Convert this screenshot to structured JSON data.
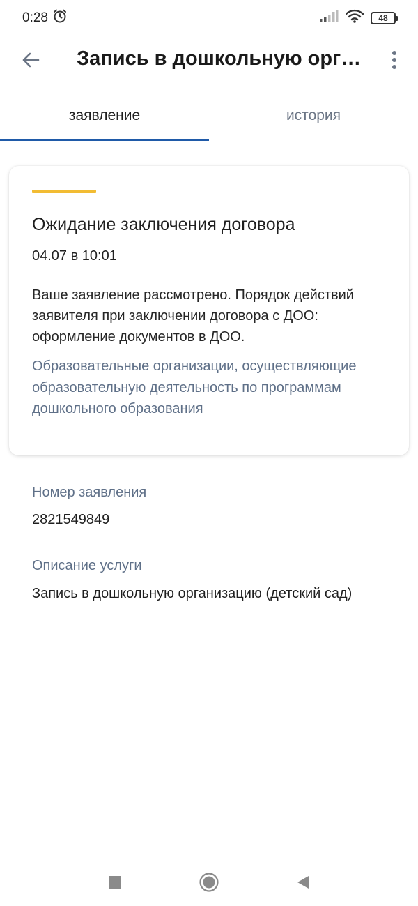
{
  "status_bar": {
    "time": "0:28",
    "battery": "48",
    "icons": [
      "alarm-icon",
      "signal-icon",
      "wifi-icon",
      "battery-icon"
    ]
  },
  "app_bar": {
    "title": "Запись в дошкольную орг…",
    "back_icon": "arrow-left-icon",
    "menu_icon": "more-vertical-icon"
  },
  "tabs": [
    {
      "label": "заявление",
      "active": true
    },
    {
      "label": "история",
      "active": false
    }
  ],
  "status_card": {
    "accent_color": "#f2bc33",
    "title": "Ожидание заключения договора",
    "date": "04.07 в 10:01",
    "text": "Ваше заявление рассмотрено. Порядок действий заявителя при заключении договора с ДОО: оформление документов в ДОО.",
    "link": "Образовательные организации, осуществляющие образовательную деятельность по программам дошкольного образования"
  },
  "application": {
    "number_label": "Номер заявления",
    "number_value": "2821549849",
    "description_label": "Описание услуги",
    "description_value": "Запись в дошкольную организацию (детский сад)"
  },
  "colors": {
    "tab_indicator": "#1f5aa8",
    "secondary_text": "#5f7088"
  },
  "nav_bar": {
    "icons": [
      "square-recents-icon",
      "circle-home-icon",
      "triangle-back-icon"
    ]
  }
}
